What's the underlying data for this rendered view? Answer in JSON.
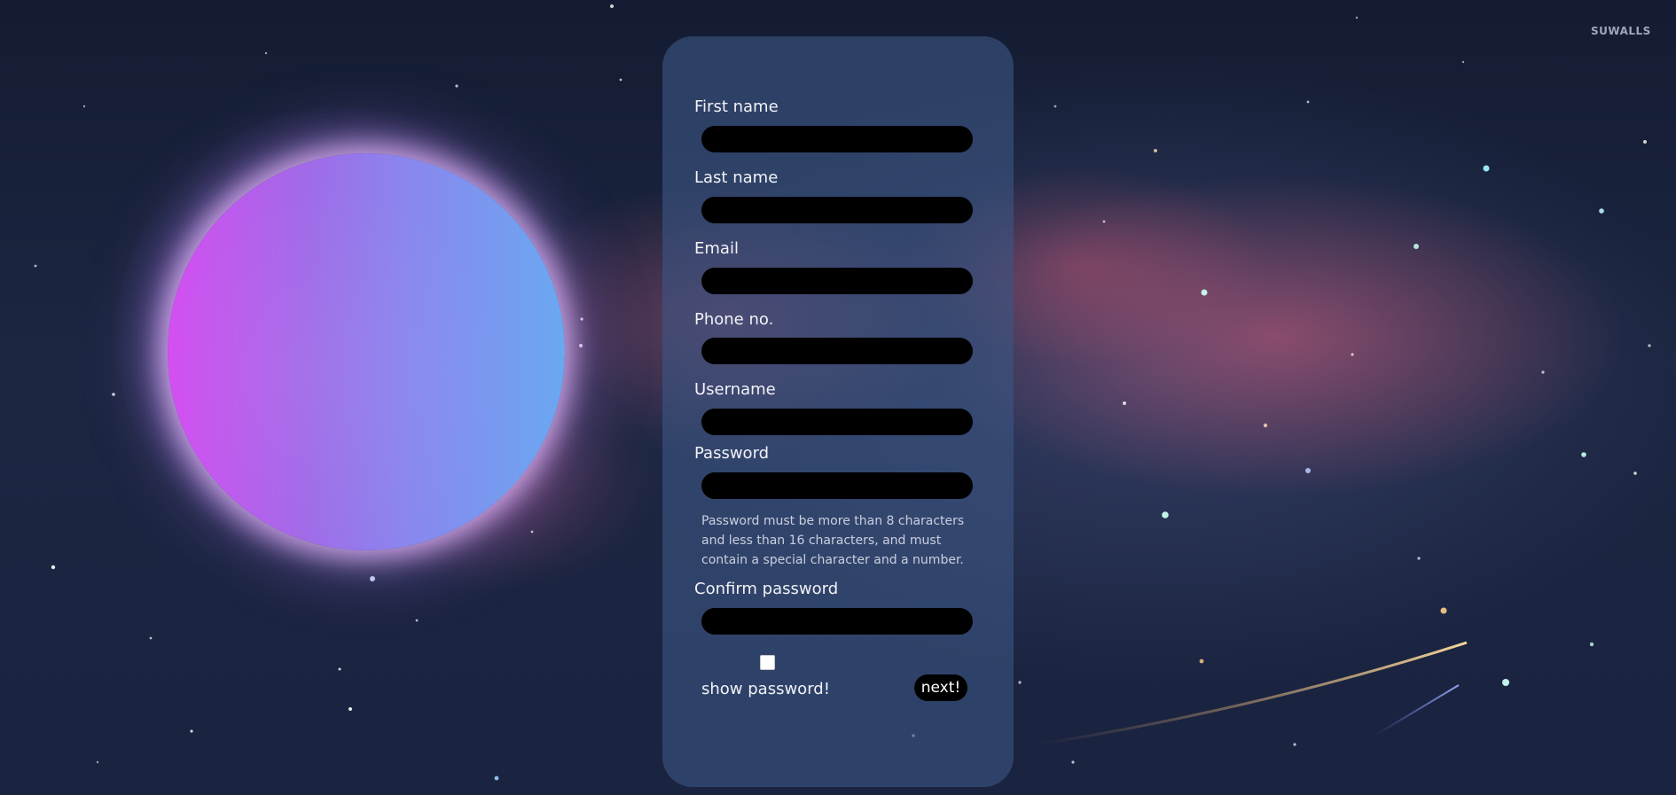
{
  "watermark": "SUWALLS",
  "form": {
    "fields": [
      {
        "label": "First name",
        "value": ""
      },
      {
        "label": "Last name",
        "value": ""
      },
      {
        "label": "Email",
        "value": ""
      },
      {
        "label": "Phone no.",
        "value": ""
      },
      {
        "label": "Username",
        "value": ""
      },
      {
        "label": "Password",
        "value": ""
      },
      {
        "label": "Confirm password",
        "value": ""
      }
    ],
    "password_hint": "Password must be more than 8 characters and less than 16 characters, and must contain a special character and a number.",
    "show_password_label": "show password!",
    "show_password_checked": false,
    "next_label": "next!"
  },
  "colors": {
    "card": "#3c5582",
    "input": "#000000",
    "planet_left": "#d34cf1",
    "planet_right": "#6aa8f0"
  }
}
